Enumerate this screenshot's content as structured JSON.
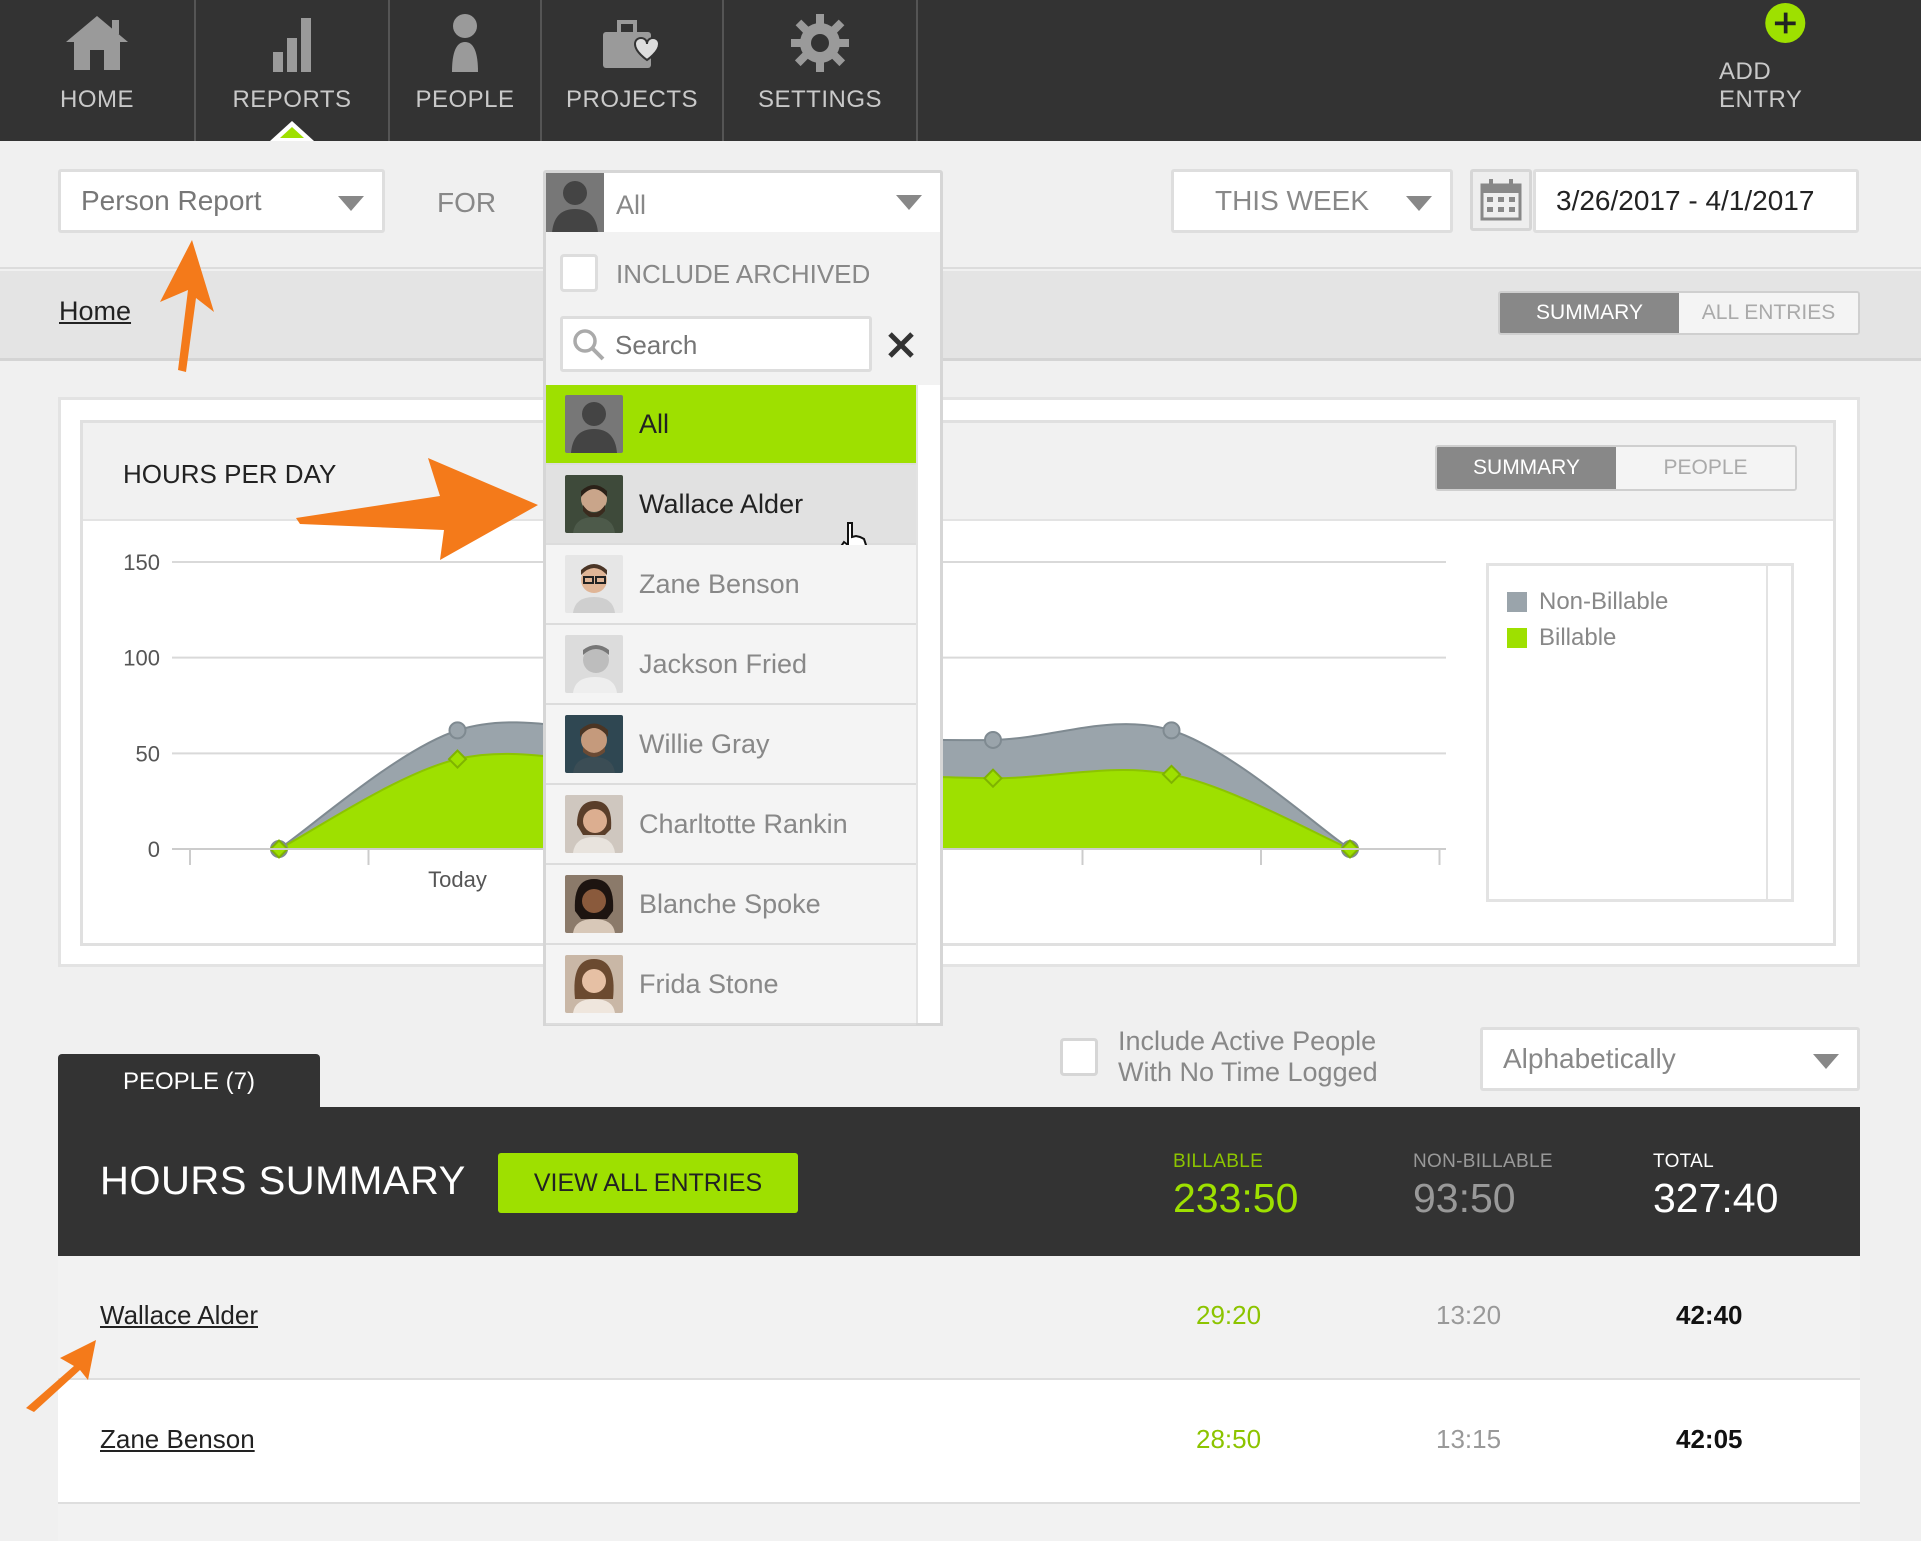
{
  "nav": {
    "items": [
      {
        "label": "HOME",
        "icon": "home-icon"
      },
      {
        "label": "REPORTS",
        "icon": "bar-chart-icon"
      },
      {
        "label": "PEOPLE",
        "icon": "person-icon"
      },
      {
        "label": "PROJECTS",
        "icon": "briefcase-heart-icon"
      },
      {
        "label": "SETTINGS",
        "icon": "gear-icon"
      }
    ],
    "add_entry": "ADD ENTRY",
    "add_icon": "plus-circle-icon",
    "active": "REPORTS"
  },
  "filters": {
    "report_type": "Person Report",
    "for_label": "FOR",
    "person_selected": "All",
    "period": "THIS WEEK",
    "date_range": "3/26/2017 - 4/1/2017"
  },
  "dropdown": {
    "include_archived": "INCLUDE ARCHIVED",
    "search_placeholder": "Search",
    "items": [
      "All",
      "Wallace Alder",
      "Zane Benson",
      "Jackson Fried",
      "Willie Gray",
      "Charltotte Rankin",
      "Blanche Spoke",
      "Frida Stone"
    ]
  },
  "breadcrumb": {
    "home": "Home"
  },
  "view_toggle": {
    "summary": "SUMMARY",
    "all_entries": "ALL ENTRIES"
  },
  "chart_panel": {
    "title": "HOURS PER DAY",
    "toggle_summary": "SUMMARY",
    "toggle_people": "PEOPLE"
  },
  "chart_data": {
    "type": "area",
    "ylim": [
      0,
      150
    ],
    "yticks": [
      0,
      50,
      100,
      150
    ],
    "x_tick_labels": [
      "",
      "Today",
      "",
      "",
      "",
      "",
      ""
    ],
    "x_index": [
      0,
      1,
      2,
      3,
      4,
      5,
      6
    ],
    "series": [
      {
        "name": "Non-Billable",
        "color": "#9aa4ab",
        "values": [
          0,
          62,
          null,
          null,
          57,
          62,
          0
        ]
      },
      {
        "name": "Billable",
        "color": "#9ee000",
        "values": [
          0,
          47,
          null,
          null,
          37,
          39,
          0
        ]
      }
    ],
    "legend": [
      "Non-Billable",
      "Billable"
    ],
    "grid": true
  },
  "options": {
    "include_active_line1": "Include Active People",
    "include_active_line2": "With No Time Logged",
    "sort": "Alphabetically"
  },
  "people_tab": "PEOPLE (7)",
  "summary": {
    "title": "HOURS SUMMARY",
    "view_all": "VIEW ALL ENTRIES",
    "billable_label": "BILLABLE",
    "billable": "233:50",
    "nonbillable_label": "NON-BILLABLE",
    "nonbillable": "93:50",
    "total_label": "TOTAL",
    "total": "327:40"
  },
  "rows": [
    {
      "name": "Wallace Alder",
      "billable": "29:20",
      "nonbillable": "13:20",
      "total": "42:40"
    },
    {
      "name": "Zane Benson",
      "billable": "28:50",
      "nonbillable": "13:15",
      "total": "42:05"
    }
  ],
  "colors": {
    "accent": "#9ee000",
    "nav_bg": "#333333",
    "arrow": "#f47a1a"
  }
}
